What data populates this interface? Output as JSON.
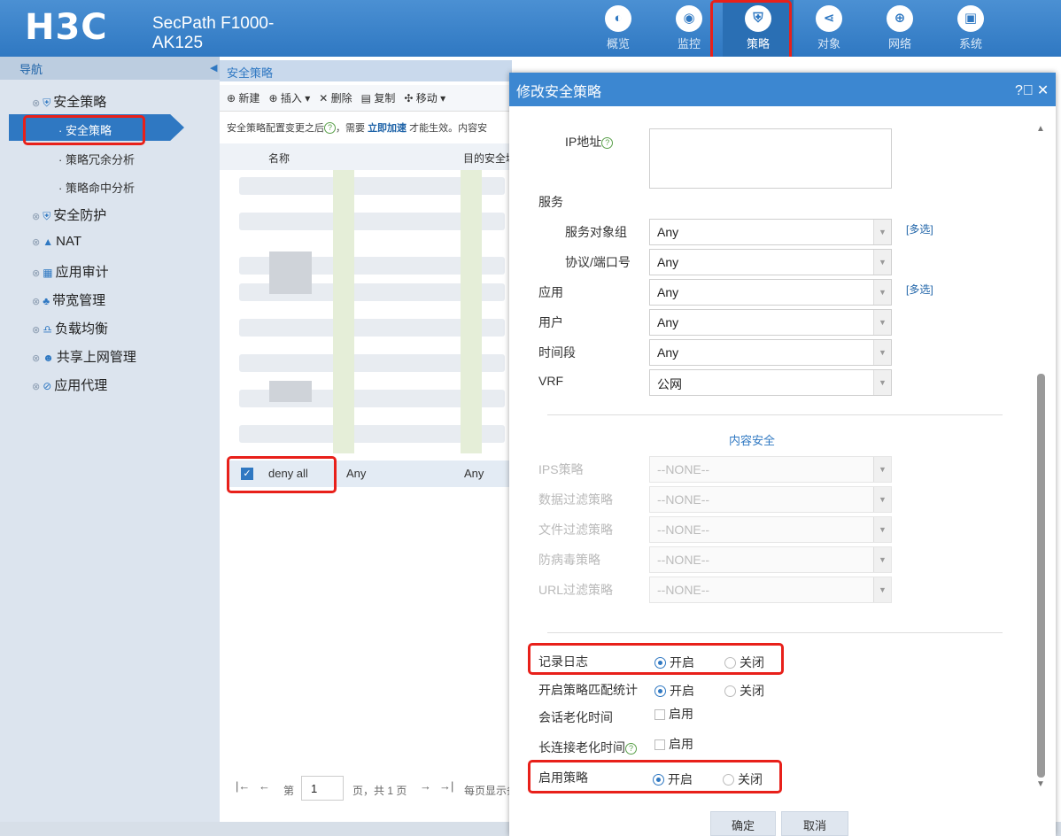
{
  "header": {
    "brand": "H3C",
    "product": "SecPath F1000-AK125",
    "nav": [
      {
        "label": "概览",
        "icon": "dashboard-icon",
        "glyph": "◐"
      },
      {
        "label": "监控",
        "icon": "monitor-icon",
        "glyph": "◉"
      },
      {
        "label": "策略",
        "icon": "shield-icon",
        "glyph": "⛨",
        "active": true
      },
      {
        "label": "对象",
        "icon": "share-icon",
        "glyph": "⋖"
      },
      {
        "label": "网络",
        "icon": "globe-icon",
        "glyph": "⊕"
      },
      {
        "label": "系统",
        "icon": "system-icon",
        "glyph": "▣"
      }
    ]
  },
  "sidebar": {
    "title": "导航",
    "items": [
      {
        "label": "安全策略"
      },
      {
        "label": "安全策略"
      },
      {
        "label": "策略冗余分析"
      },
      {
        "label": "策略命中分析"
      },
      {
        "label": "安全防护"
      },
      {
        "label": "NAT"
      },
      {
        "label": "应用审计"
      },
      {
        "label": "带宽管理"
      },
      {
        "label": "负载均衡"
      },
      {
        "label": "共享上网管理"
      },
      {
        "label": "应用代理"
      }
    ]
  },
  "main": {
    "title": "安全策略",
    "toolbar": {
      "new": "新建",
      "insert": "插入",
      "delete": "删除",
      "copy": "复制",
      "move": "移动"
    },
    "notice_pre": "安全策略配置变更之后",
    "notice_mid": "，需要 ",
    "notice_link": "立即加速",
    "notice_post": " 才能生效。内容安",
    "col_name": "名称",
    "col_dst": "目的安全域",
    "row_name": "deny all",
    "row_col2": "Any",
    "row_col3": "Any",
    "pager": {
      "first": "|←",
      "prev": "←",
      "page_label": "第",
      "page_num": "1",
      "page_total": "页，共 1 页",
      "next": "→",
      "last": "→|",
      "per_page": "每页显示条"
    }
  },
  "dialog": {
    "title": "修改安全策略",
    "ip_label": "IP地址",
    "service_label": "服务",
    "service_group_label": "服务对象组",
    "service_group_value": "Any",
    "proto_label": "协议/端口号",
    "proto_value": "Any",
    "app_label": "应用",
    "app_value": "Any",
    "user_label": "用户",
    "user_value": "Any",
    "time_label": "时间段",
    "time_value": "Any",
    "vrf_label": "VRF",
    "vrf_value": "公网",
    "multi_select": "[多选]",
    "content_security": "内容安全",
    "ips_label": "IPS策略",
    "data_filter_label": "数据过滤策略",
    "file_filter_label": "文件过滤策略",
    "av_label": "防病毒策略",
    "url_filter_label": "URL过滤策略",
    "none_value": "--NONE--",
    "log_label": "记录日志",
    "match_stat_label": "开启策略匹配统计",
    "session_aging_label": "会话老化时间",
    "long_conn_label": "长连接老化时间",
    "enable_policy_label": "启用策略",
    "on": "开启",
    "off": "关闭",
    "enable": "启用",
    "ok": "确定",
    "cancel": "取消"
  },
  "colors": {
    "header": "#2f78c2",
    "highlight": "#e8201a"
  }
}
